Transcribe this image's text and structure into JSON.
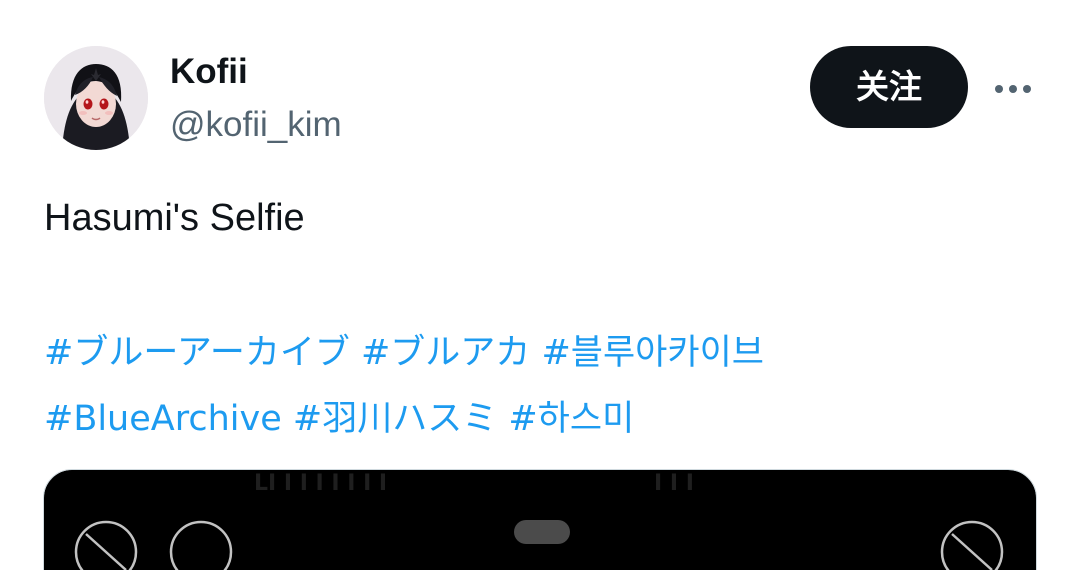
{
  "author": {
    "display_name": "Kofii",
    "handle": "@kofii_kim",
    "avatar_icon": "anime-avatar"
  },
  "actions": {
    "follow_label": "关注",
    "more_icon": "more-horizontal-icon"
  },
  "tweet": {
    "text": "Hasumi's Selfie",
    "hashtag_lines": [
      [
        "#ブルーアーカイブ",
        "#ブルアカ",
        "#블루아카이브"
      ],
      [
        "#BlueArchive",
        "#羽川ハスミ",
        "#하스미"
      ]
    ]
  },
  "media": {
    "icon": "media-preview"
  },
  "colors": {
    "text_primary": "#0f1419",
    "text_secondary": "#536471",
    "link": "#1d9bf0",
    "button_bg": "#0f1419",
    "button_text": "#ffffff",
    "media_bg": "#000000"
  }
}
